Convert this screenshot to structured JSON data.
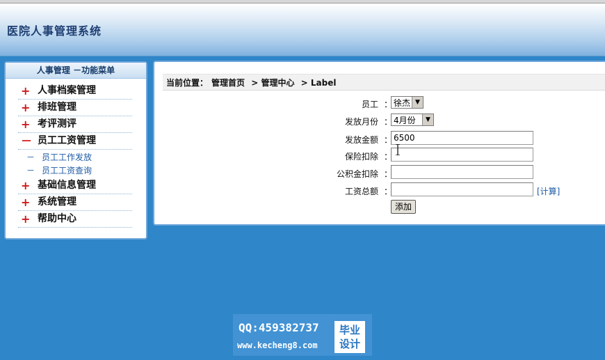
{
  "app": {
    "title": "医院人事管理系统"
  },
  "sidebar": {
    "header": "人事管理 －功能菜单",
    "items": [
      {
        "symbol": "+",
        "label": "人事档案管理"
      },
      {
        "symbol": "+",
        "label": "排班管理"
      },
      {
        "symbol": "+",
        "label": "考评测评"
      },
      {
        "symbol": "－",
        "label": "员工工资管理",
        "children": [
          "员工工作发放",
          "员工工资查询"
        ]
      },
      {
        "symbol": "+",
        "label": "基础信息管理"
      },
      {
        "symbol": "+",
        "label": "系统管理"
      },
      {
        "symbol": "+",
        "label": "帮助中心"
      }
    ],
    "sub_dash": "－"
  },
  "breadcrumb": {
    "prefix": "当前位置：",
    "items": [
      "管理首页",
      "> 管理中心",
      "> Label"
    ]
  },
  "form": {
    "colon": "：",
    "employee": {
      "label": "员工",
      "value": "徐杰"
    },
    "month": {
      "label": "发放月份",
      "value": "4月份"
    },
    "amount": {
      "label": "发放金额",
      "value": "6500"
    },
    "insurance": {
      "label": "保险扣除",
      "value": ""
    },
    "fund": {
      "label": "公积金扣除",
      "value": ""
    },
    "total": {
      "label": "工资总额",
      "value": ""
    },
    "calc_link": "[计算]",
    "add_button": "添加"
  },
  "watermark": {
    "qq": "QQ:459382737",
    "url": "www.kecheng8.com",
    "badge_line1": "毕业",
    "badge_line2": "设计"
  },
  "colors": {
    "background": "#2f86c9",
    "menu_symbol": "#d01818",
    "link": "#1d5aa6"
  }
}
